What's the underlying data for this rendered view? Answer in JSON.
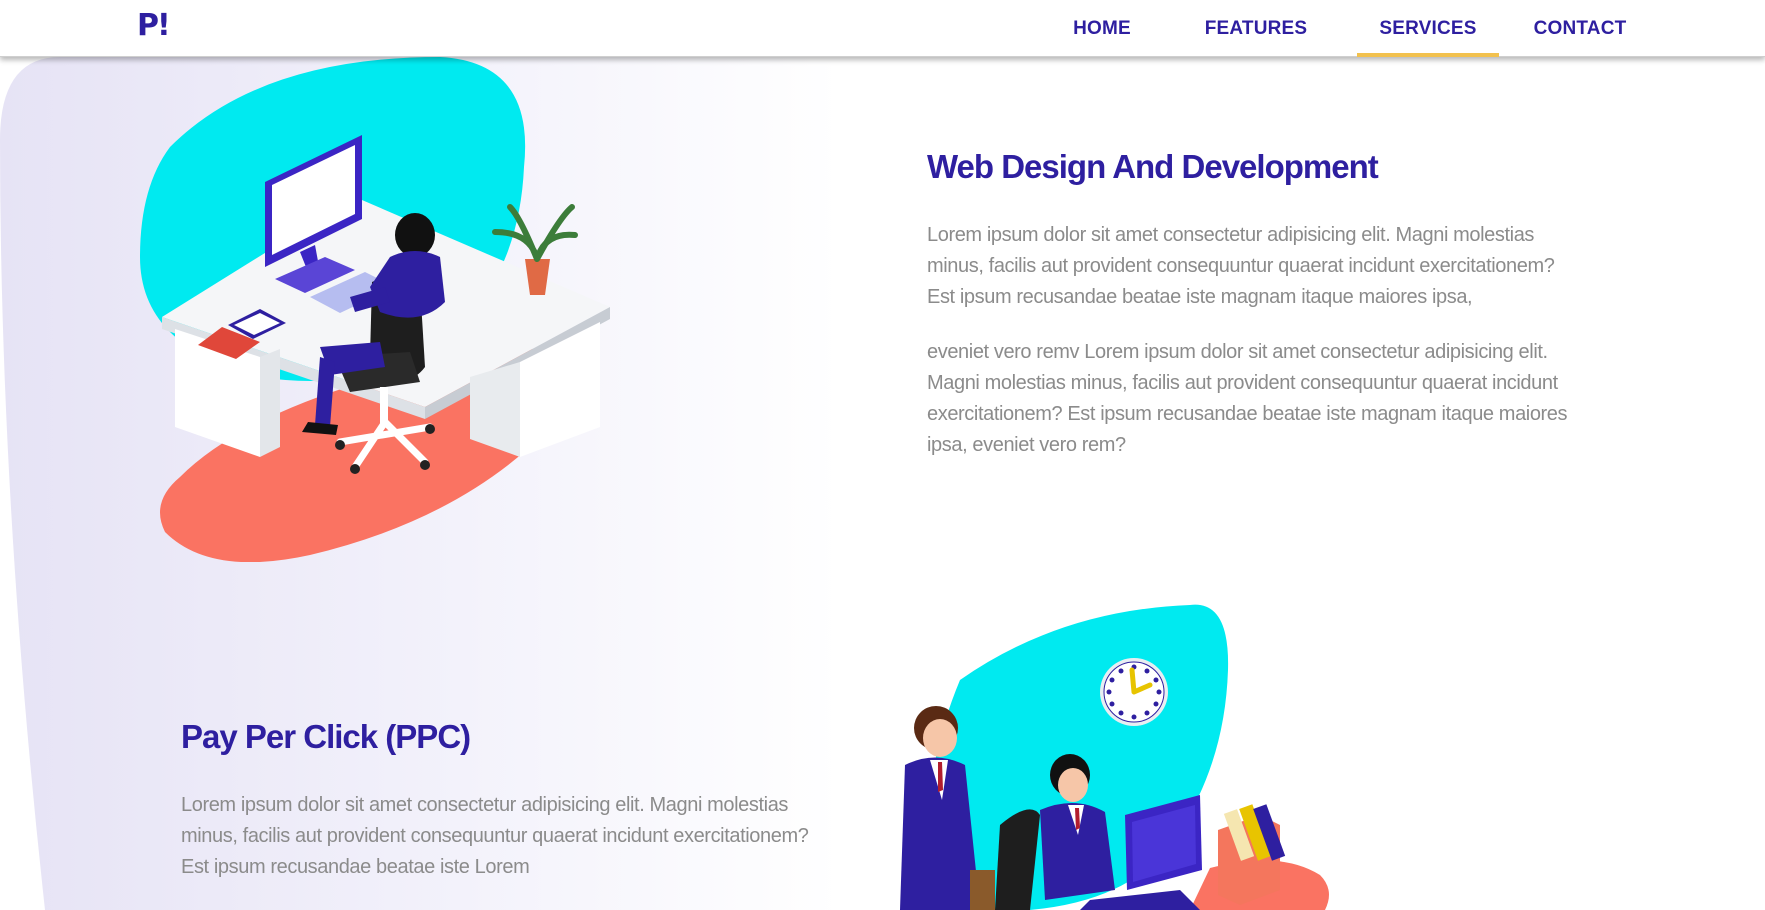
{
  "brand": {
    "logo_text": "P!"
  },
  "nav": {
    "items": [
      {
        "label": "HOME",
        "active": false
      },
      {
        "label": "FEATURES",
        "active": false
      },
      {
        "label": "SERVICES",
        "active": true
      },
      {
        "label": "CONTACT",
        "active": false
      }
    ]
  },
  "services": [
    {
      "title": "Web Design And Development",
      "paragraphs": [
        "Lorem ipsum dolor sit amet consectetur adipisicing elit. Magni molestias minus, facilis aut provident consequuntur quaerat incidunt exercitationem? Est ipsum recusandae beatae iste magnam itaque maiores ipsa,",
        "eveniet vero remv Lorem ipsum dolor sit amet consectetur adipisicing elit. Magni molestias minus, facilis aut provident consequuntur quaerat incidunt exercitationem? Est ipsum recusandae beatae iste magnam itaque maiores ipsa, eveniet vero rem?"
      ],
      "illustration_icon": "office-desk-worker-illustration"
    },
    {
      "title": "Pay Per Click (PPC)",
      "paragraphs": [
        "Lorem ipsum dolor sit amet consectetur adipisicing elit. Magni molestias minus, facilis aut provident consequuntur quaerat incidunt exercitationem? Est ipsum recusandae beatae iste Lorem"
      ],
      "illustration_icon": "business-meeting-illustration"
    }
  ],
  "theme": {
    "primary": "#2e1fa0",
    "accent": "#f2c14e",
    "cyan": "#00eaf0",
    "coral": "#fa7362",
    "text_muted": "#8b8b8b",
    "swoosh": "#ebe9f7"
  }
}
